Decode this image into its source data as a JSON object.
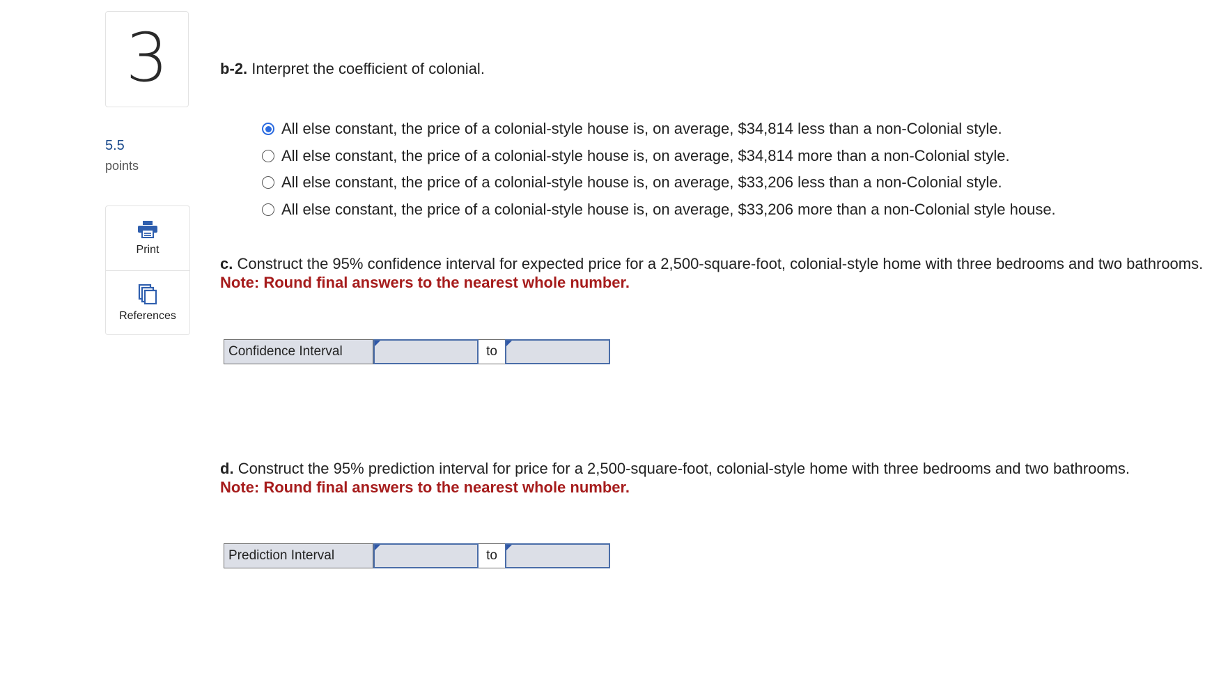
{
  "question": {
    "number": "3",
    "points_value": "5.5",
    "points_label": "points"
  },
  "tools": {
    "print_label": "Print",
    "references_label": "References"
  },
  "b2": {
    "label": "b-2.",
    "prompt": "Interpret the coefficient of colonial.",
    "options": [
      {
        "text": "All else constant, the price of a colonial-style house is, on average, $34,814 less than a non-Colonial style.",
        "selected": true
      },
      {
        "text": "All else constant, the price of a colonial-style house is, on average, $34,814 more than a non-Colonial style.",
        "selected": false
      },
      {
        "text": "All else constant, the price of a colonial-style house is, on average, $33,206 less than a non-Colonial style.",
        "selected": false
      },
      {
        "text": "All else constant, the price of a colonial-style house is, on average, $33,206 more than a non-Colonial style house.",
        "selected": false
      }
    ]
  },
  "c": {
    "label": "c.",
    "prompt": "Construct the 95% confidence interval for expected price for a 2,500-square-foot, colonial-style home with three bedrooms and two bathrooms.",
    "note": "Note: Round final answers to the nearest whole number.",
    "row_label": "Confidence Interval",
    "to_label": "to",
    "lower_value": "",
    "upper_value": ""
  },
  "d": {
    "label": "d.",
    "prompt": "Construct the 95% prediction interval for price for a 2,500-square-foot, colonial-style home with three bedrooms and two bathrooms.",
    "note": "Note: Round final answers to the nearest whole number.",
    "row_label": "Prediction Interval",
    "to_label": "to",
    "lower_value": "",
    "upper_value": ""
  },
  "colors": {
    "accent": "#2b6be0",
    "note_red": "#a61c1c",
    "points_blue": "#1a4a8c",
    "input_bg": "#dcdfe7"
  },
  "icons": {
    "print": "printer-icon",
    "references": "documents-icon"
  }
}
